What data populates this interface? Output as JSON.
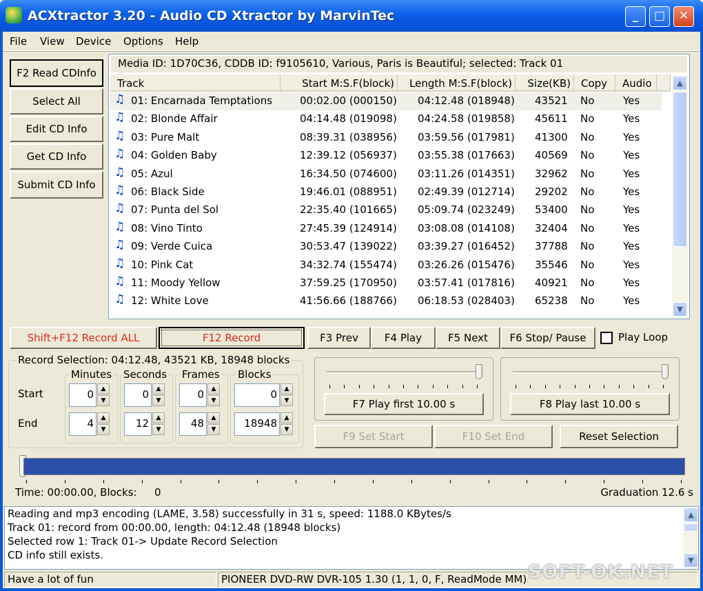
{
  "window": {
    "title": "ACXtractor 3.20 - Audio CD Xtractor by MarvinTec",
    "minimize": "_",
    "maximize": "□",
    "close": "✕"
  },
  "menu": [
    "File",
    "View",
    "Device",
    "Options",
    "Help"
  ],
  "left_buttons": [
    "F2 Read CDInfo",
    "Select All",
    "Edit CD Info",
    "Get CD Info",
    "Submit CD Info"
  ],
  "media_info": "Media ID: 1D70C36, CDDB ID: f9105610, Various, Paris is Beautiful; selected: Track 01",
  "columns": [
    "Track",
    "Start M:S.F(block)",
    "Length M:S.F(block)",
    "Size(KB)",
    "Copy",
    "Audio"
  ],
  "tracks": [
    {
      "name": "01: Encarnada Temptations",
      "start": "00:02.00 (000150)",
      "length": "04:12.48 (018948)",
      "size": "43521",
      "copy": "No",
      "audio": "Yes"
    },
    {
      "name": "02: Blonde Affair",
      "start": "04:14.48 (019098)",
      "length": "04:24.58 (019858)",
      "size": "45611",
      "copy": "No",
      "audio": "Yes"
    },
    {
      "name": "03: Pure Malt",
      "start": "08:39.31 (038956)",
      "length": "03:59.56 (017981)",
      "size": "41300",
      "copy": "No",
      "audio": "Yes"
    },
    {
      "name": "04: Golden Baby",
      "start": "12:39.12 (056937)",
      "length": "03:55.38 (017663)",
      "size": "40569",
      "copy": "No",
      "audio": "Yes"
    },
    {
      "name": "05: Azul",
      "start": "16:34.50 (074600)",
      "length": "03:11.26 (014351)",
      "size": "32962",
      "copy": "No",
      "audio": "Yes"
    },
    {
      "name": "06: Black Side",
      "start": "19:46.01 (088951)",
      "length": "02:49.39 (012714)",
      "size": "29202",
      "copy": "No",
      "audio": "Yes"
    },
    {
      "name": "07: Punta del Sol",
      "start": "22:35.40 (101665)",
      "length": "05:09.74 (023249)",
      "size": "53400",
      "copy": "No",
      "audio": "Yes"
    },
    {
      "name": "08: Vino Tinto",
      "start": "27:45.39 (124914)",
      "length": "03:08.08 (014108)",
      "size": "32404",
      "copy": "No",
      "audio": "Yes"
    },
    {
      "name": "09: Verde Cuica",
      "start": "30:53.47 (139022)",
      "length": "03:39.27 (016452)",
      "size": "37788",
      "copy": "No",
      "audio": "Yes"
    },
    {
      "name": "10: Pink Cat",
      "start": "34:32.74 (155474)",
      "length": "03:26.26 (015476)",
      "size": "35546",
      "copy": "No",
      "audio": "Yes"
    },
    {
      "name": "11: Moody Yellow",
      "start": "37:59.25 (170950)",
      "length": "03:57.41 (017816)",
      "size": "40921",
      "copy": "No",
      "audio": "Yes"
    },
    {
      "name": "12: White Love",
      "start": "41:56.66 (188766)",
      "length": "06:18.53 (028403)",
      "size": "65238",
      "copy": "No",
      "audio": "Yes"
    }
  ],
  "record_all": "Shift+F12 Record ALL",
  "record": "F12 Record",
  "transport": [
    "F3 Prev",
    "F4 Play",
    "F5 Next",
    "F6 Stop/ Pause"
  ],
  "play_loop": "Play Loop",
  "record_selection": {
    "title": "Record Selection: 04:12.48, 43521 KB, 18948 blocks",
    "headers": [
      "Minutes",
      "Seconds",
      "Frames",
      "Blocks"
    ],
    "start_label": "Start",
    "end_label": "End",
    "start": [
      "0",
      "0",
      "0",
      "0"
    ],
    "end": [
      "4",
      "12",
      "48",
      "18948"
    ]
  },
  "play_first": "F7 Play first 10.00 s",
  "play_last": "F8 Play last 10.00 s",
  "set_start": "F9 Set Start",
  "set_end": "F10 Set End",
  "reset_selection": "Reset Selection",
  "position": {
    "time_label": "Time: 00:00.00, Blocks:",
    "blocks": "0",
    "graduation": "Graduation 12.6 s"
  },
  "log": [
    "Reading and mp3 encoding (LAME, 3.58) successfully in 31 s, speed: 1188.0 KBytes/s",
    "Track 01: record from 00:00.00, length: 04:12.48 (18948 blocks)",
    "Selected row   1: Track 01-> Update Record Selection",
    " CD info still exists."
  ],
  "status": {
    "left": "Have a lot of fun",
    "drive": "PIONEER DVD-RW  DVR-105 1.30 (1, 1, 0, F, ReadMode MM)"
  },
  "watermark": "SOFT-OK.NET"
}
